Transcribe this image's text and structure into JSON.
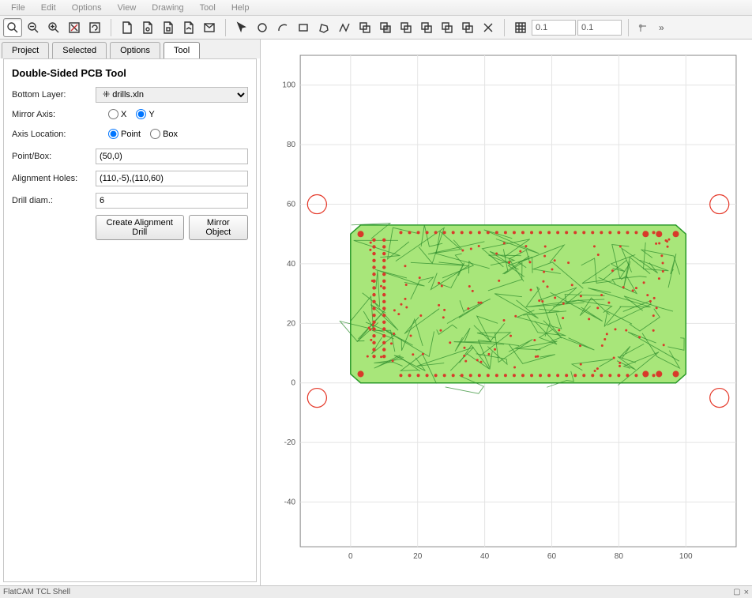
{
  "menu": {
    "file": "File",
    "edit": "Edit",
    "options": "Options",
    "view": "View",
    "drawing": "Drawing",
    "tool": "Tool",
    "help": "Help"
  },
  "toolbar": {
    "coord_x": "0.1",
    "coord_y": "0.1"
  },
  "tabs": {
    "project": "Project",
    "selected": "Selected",
    "options": "Options",
    "tool": "Tool"
  },
  "panel": {
    "title": "Double-Sided PCB Tool",
    "bottom_layer_label": "Bottom Layer:",
    "bottom_layer_value": "drills.xln",
    "mirror_axis_label": "Mirror Axis:",
    "mirror_x": "X",
    "mirror_y": "Y",
    "axis_location_label": "Axis Location:",
    "loc_point": "Point",
    "loc_box": "Box",
    "pointbox_label": "Point/Box:",
    "pointbox_value": "(50,0)",
    "align_label": "Alignment Holes:",
    "align_value": "(110,-5),(110,60)",
    "drill_label": "Drill diam.:",
    "drill_value": "6",
    "btn_create": "Create Alignment Drill",
    "btn_mirror": "Mirror Object"
  },
  "plot": {
    "x_ticks": [
      "0",
      "20",
      "40",
      "60",
      "80",
      "100"
    ],
    "y_ticks": [
      "-40",
      "-20",
      "0",
      "20",
      "40",
      "60",
      "80",
      "100"
    ]
  },
  "status": {
    "shell": "FlatCAM TCL Shell"
  }
}
